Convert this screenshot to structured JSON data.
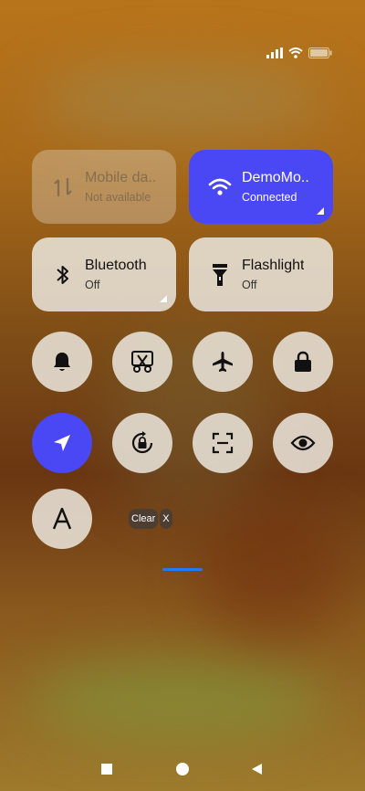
{
  "tiles": [
    {
      "title": "Mobile da..",
      "subtitle": "Not available"
    },
    {
      "title": "DemoMo..",
      "subtitle": "Connected"
    },
    {
      "title": "Bluetooth",
      "subtitle": "Off"
    },
    {
      "title": "Flashlight",
      "subtitle": "Off"
    }
  ],
  "toggles": [
    {
      "icon": "bell-icon"
    },
    {
      "icon": "screenshot-scissors-icon"
    },
    {
      "icon": "airplane-icon"
    },
    {
      "icon": "lock-icon"
    },
    {
      "icon": "location-arrow-icon"
    },
    {
      "icon": "rotation-lock-icon"
    },
    {
      "icon": "scan-frame-icon"
    },
    {
      "icon": "eye-icon"
    },
    {
      "icon": "font-a-icon"
    }
  ],
  "clear": {
    "label": "Clear",
    "x_label": "X"
  },
  "colors": {
    "active": "#4a47f5",
    "tile": "#e8e2d8",
    "indicator": "#1f7cf2"
  }
}
